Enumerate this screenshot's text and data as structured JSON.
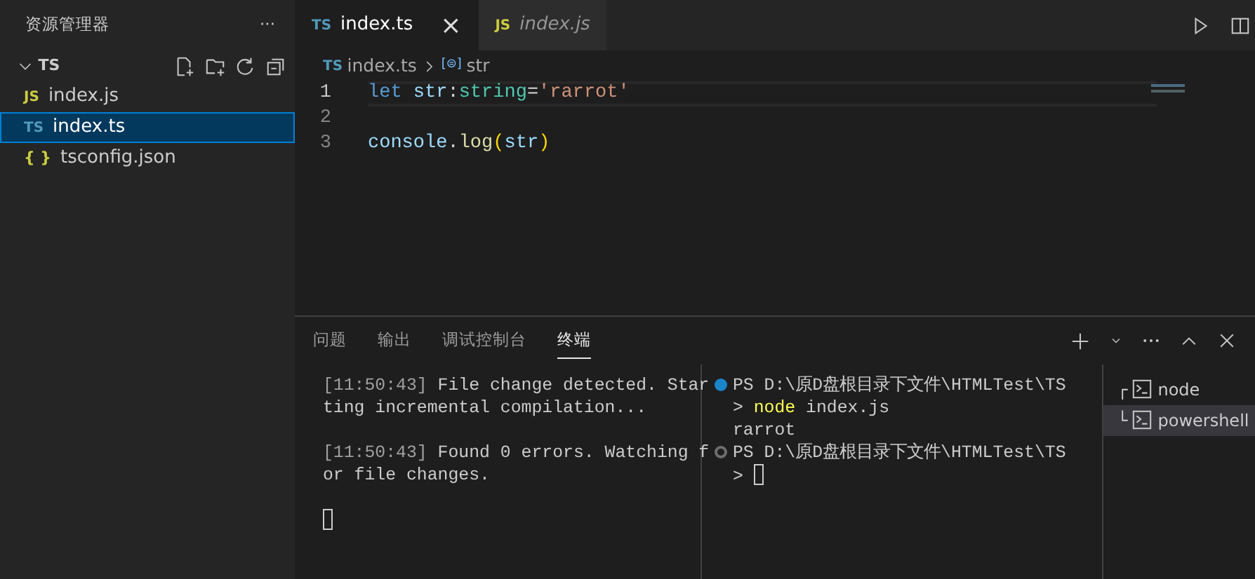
{
  "sidebar": {
    "title": "资源管理器",
    "more": "···",
    "folder": {
      "label": "TS",
      "expanded": true
    },
    "files": [
      {
        "icon": "JS",
        "kind": "js",
        "label": "index.js",
        "selected": false
      },
      {
        "icon": "TS",
        "kind": "ts",
        "label": "index.ts",
        "selected": true
      },
      {
        "icon": "{ }",
        "kind": "json",
        "label": "tsconfig.json",
        "selected": false
      }
    ]
  },
  "tabs": [
    {
      "icon": "TS",
      "kind": "ts",
      "label": "index.ts",
      "selected": true,
      "preview": false,
      "close": "×"
    },
    {
      "icon": "JS",
      "kind": "js",
      "label": "index.js",
      "selected": false,
      "preview": true
    }
  ],
  "breadcrumb": [
    {
      "icon": "TS",
      "kind": "ts",
      "label": "index.ts"
    },
    {
      "icon": "[⊜]",
      "kind": "var",
      "label": "str"
    }
  ],
  "code": [
    {
      "number": "1",
      "current": true,
      "tokens": [
        {
          "kind": "keyword",
          "text": "let"
        },
        {
          "kind": "variable",
          "text": " str"
        },
        {
          "kind": "plain",
          "text": ":"
        },
        {
          "kind": "type",
          "text": "string"
        },
        {
          "kind": "plain",
          "text": "="
        },
        {
          "kind": "string",
          "text": "'rarrot'"
        }
      ]
    },
    {
      "number": "2",
      "current": false
    },
    {
      "number": "3",
      "current": false,
      "tokens": [
        {
          "kind": "variable",
          "text": "console"
        },
        {
          "kind": "plain",
          "text": "."
        },
        {
          "kind": "function",
          "text": "log"
        },
        {
          "kind": "paren",
          "text": "("
        },
        {
          "kind": "variable",
          "text": "str"
        },
        {
          "kind": "paren",
          "text": ")"
        }
      ]
    }
  ],
  "panel": {
    "tabs": [
      {
        "label": "问题",
        "selected": false
      },
      {
        "label": "输出",
        "selected": false
      },
      {
        "label": "调试控制台",
        "selected": false
      },
      {
        "label": "终端",
        "selected": true
      }
    ],
    "terminal_left": [
      {
        "segments": [
          {
            "kind": "time",
            "text": "[11:50:43]"
          },
          {
            "kind": "plain",
            "text": " File change detected. Star"
          }
        ]
      },
      {
        "segments": [
          {
            "kind": "plain",
            "text": "ting incremental compilation..."
          }
        ]
      },
      {
        "gap_before": true,
        "segments": [
          {
            "kind": "time",
            "text": "[11:50:43]"
          },
          {
            "kind": "plain",
            "text": " Found 0 errors. Watching f"
          }
        ]
      },
      {
        "segments": [
          {
            "kind": "plain",
            "text": "or file changes."
          }
        ]
      },
      {
        "gap_before": true,
        "cursor": true
      }
    ],
    "terminal_right": [
      {
        "succeeded": true,
        "segments": [
          {
            "kind": "plain",
            "text": "PS D:\\原D盘根目录下文件\\HTMLTest\\TS"
          }
        ]
      },
      {
        "segments": [
          {
            "kind": "plain",
            "text": "> "
          },
          {
            "kind": "command",
            "text": "node"
          },
          {
            "kind": "plain",
            "text": " index.js"
          }
        ]
      },
      {
        "segments": [
          {
            "kind": "plain",
            "text": "rarrot"
          }
        ]
      },
      {
        "succeeded": false,
        "segments": [
          {
            "kind": "plain",
            "text": "PS D:\\原D盘根目录下文件\\HTMLTest\\TS"
          }
        ]
      },
      {
        "segments": [
          {
            "kind": "plain",
            "text": "> "
          }
        ],
        "cursor": true
      }
    ],
    "terminals": [
      {
        "branch": "┌",
        "label": "node",
        "selected": false
      },
      {
        "branch": "└",
        "label": "powershell",
        "selected": true
      }
    ]
  }
}
